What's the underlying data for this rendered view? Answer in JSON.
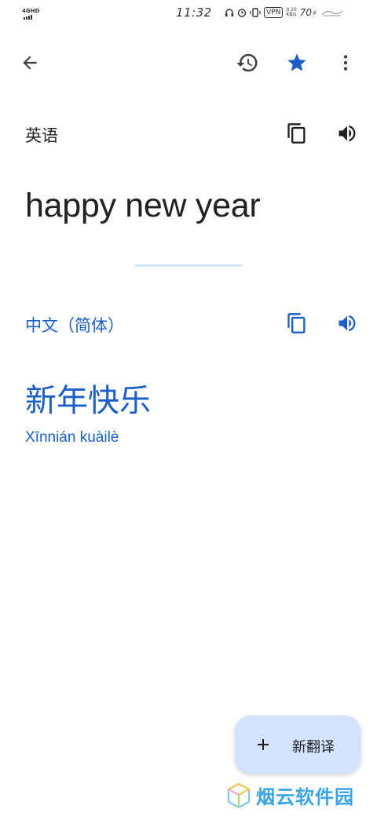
{
  "status_bar": {
    "network": "4GHD",
    "time": "11:32",
    "vpn": "VPN",
    "speed_value": "0.10",
    "speed_unit": "KB/s",
    "battery": "70"
  },
  "toolbar": {
    "back_icon": "arrow-left-icon",
    "history_icon": "history-icon",
    "star_icon": "star-icon",
    "more_icon": "more-vert-icon",
    "star_color": "#1a5fc8"
  },
  "source": {
    "language": "英语",
    "text": "happy new year"
  },
  "target": {
    "language": "中文（简体）",
    "text": "新年快乐",
    "romanization": "Xīnnián kuàilè",
    "accent_color": "#1a5fc8"
  },
  "fab": {
    "label": "新翻译",
    "icon": "plus-icon"
  },
  "watermark": {
    "text": "烟云软件园"
  }
}
